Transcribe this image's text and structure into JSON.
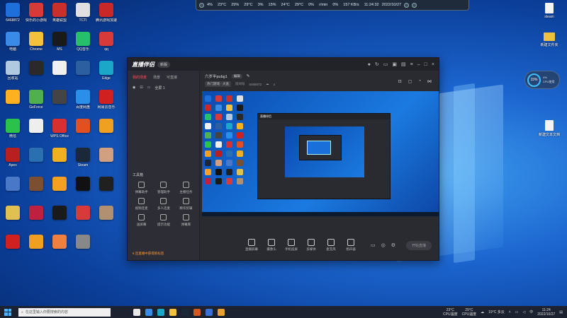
{
  "desktop": {
    "left_icons": [
      {
        "label": "6468872",
        "color": "#1e6fd9"
      },
      {
        "label": "快乐的小游戏",
        "color": "#d83a3a"
      },
      {
        "label": "英雄联盟",
        "color": "#c9302c"
      },
      {
        "label": "TCTI",
        "color": "#e0e0e0"
      },
      {
        "label": "腾讯游戏加速",
        "color": "#c82828"
      },
      {
        "label": "电脑",
        "color": "#3a8ae8"
      },
      {
        "label": "Chrome",
        "color": "#f2c23a"
      },
      {
        "label": "MS",
        "color": "#1a1a1a"
      },
      {
        "label": "QQ音乐",
        "color": "#27c06a"
      },
      {
        "label": "qq",
        "color": "#d83a3a"
      },
      {
        "label": "回收站",
        "color": "#b0c8e0"
      },
      {
        "label": "",
        "color": "#2a2a2a"
      },
      {
        "label": "",
        "color": "#f0f0f0"
      },
      {
        "label": "",
        "color": "#2b5fa0"
      },
      {
        "label": "Edge",
        "color": "#1aa7c8"
      },
      {
        "label": "",
        "color": "#ffb020"
      },
      {
        "label": "GeForce",
        "color": "#50b050"
      },
      {
        "label": "",
        "color": "#444"
      },
      {
        "label": "百度网盘",
        "color": "#2a8fe8"
      },
      {
        "label": "网易云音乐",
        "color": "#d02020"
      },
      {
        "label": "微信",
        "color": "#2bc24a"
      },
      {
        "label": "",
        "color": "#eee"
      },
      {
        "label": "WPS Office",
        "color": "#d83030"
      },
      {
        "label": "",
        "color": "#e05020"
      },
      {
        "label": "",
        "color": "#f0a020"
      },
      {
        "label": "Apex",
        "color": "#b82020"
      },
      {
        "label": "",
        "color": "#2a6fb0"
      },
      {
        "label": "",
        "color": "#f0b020"
      },
      {
        "label": "Steam",
        "color": "#1b2838"
      },
      {
        "label": "",
        "color": "#d0a080"
      },
      {
        "label": "",
        "color": "#4a78c8"
      },
      {
        "label": "",
        "color": "#7a5030"
      },
      {
        "label": "",
        "color": "#f5a020"
      },
      {
        "label": "",
        "color": "#111"
      },
      {
        "label": "",
        "color": "#202020"
      },
      {
        "label": "",
        "color": "#e0c050"
      },
      {
        "label": "",
        "color": "#c02040"
      },
      {
        "label": "",
        "color": "#1a1a1a"
      },
      {
        "label": "",
        "color": "#d83a3a"
      },
      {
        "label": "",
        "color": "#b09070"
      },
      {
        "label": "",
        "color": "#d02020"
      },
      {
        "label": "",
        "color": "#f0a020"
      },
      {
        "label": "",
        "color": "#f08040"
      },
      {
        "label": "",
        "color": "#888"
      }
    ],
    "right_icons": [
      {
        "label": "steam",
        "kind": "file"
      },
      {
        "label": "新建文件夹",
        "kind": "folder"
      },
      {
        "label": "新建文本文档",
        "kind": "file"
      }
    ]
  },
  "topbar": {
    "items": [
      "4%",
      "23°C",
      "29%",
      "29°C",
      "3%",
      "15%",
      "24°C",
      "29°C",
      "0%",
      "r/min",
      "0%",
      "157 KB/s",
      "11:24:32"
    ],
    "date": "2022/10/27"
  },
  "app": {
    "logo_text": "直播伴侣",
    "version_badge": "新版",
    "side_tabs": [
      "我的场景",
      "场景",
      "可直接"
    ],
    "scene_label": "全屏 1",
    "tools_title": "工具箱",
    "tools": [
      "弹幕助手",
      "管理助手",
      "主播任务",
      "视频连麦",
      "多人连麦",
      "精华剪辑",
      "送屏幕",
      "提示功能",
      "弹幕库"
    ],
    "tip_text": "5 连直播中获得新标签",
    "room_title": "六岁半pubg1",
    "room_badge": "编辑",
    "room_tag": "热门游戏 · 大逃",
    "room_id_label": "房间号",
    "room_id": "6468872",
    "viewers": "4",
    "bottom_buttons": [
      "直播屏幕",
      "摄像头",
      "手机投屏",
      "多媒体",
      "麦克风",
      "扬声器"
    ],
    "start_live": "开始直播"
  },
  "cpu_widget": {
    "percent": "15%",
    "label": "4%",
    "sub": "CPU使用"
  },
  "taskbar": {
    "search_placeholder": "在这里输入你要搜索的内容",
    "apps": [
      "#e8e8e8",
      "#3a8ae8",
      "#1aa7c8",
      "#f2c23a",
      "#1b2838",
      "#d05a20",
      "#3a6fd8",
      "#e8a030"
    ],
    "cpu_temp": "23°C",
    "cpu_label": "CPU温度",
    "gpu_temp": "29°C",
    "gpu_label": "CPU温度",
    "weather": "19°C 多云",
    "time": "11:24",
    "date": "2022/10/27"
  }
}
